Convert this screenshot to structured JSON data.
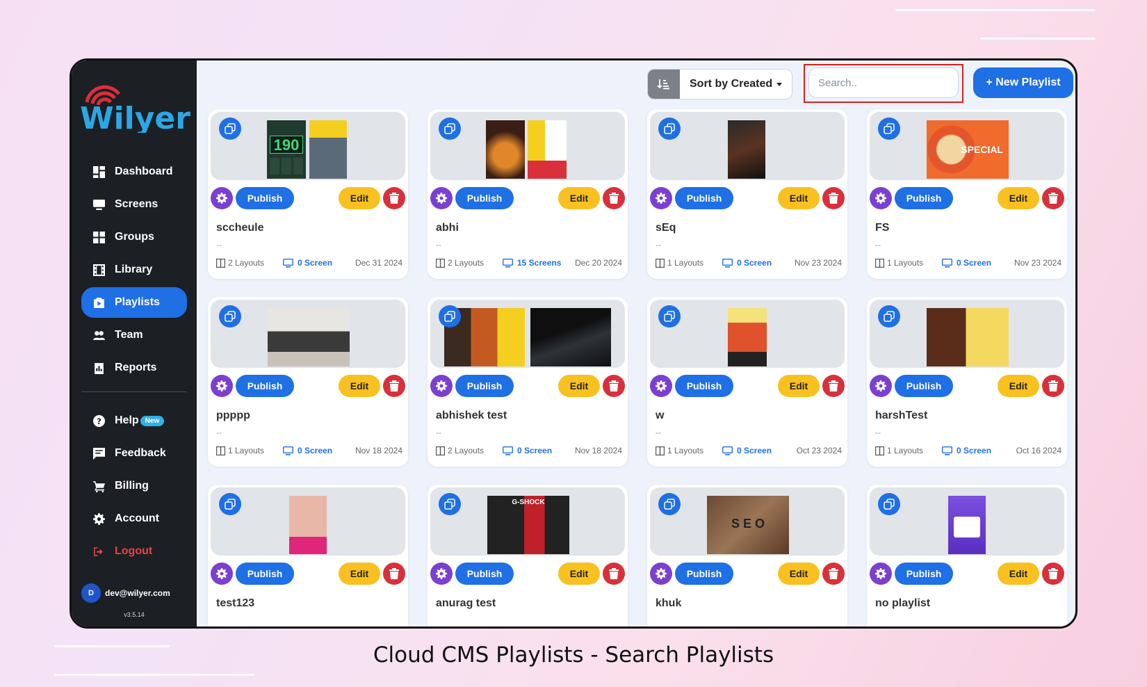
{
  "brand": {
    "logo_text": "Wilyer",
    "accent": "#1f6fe5"
  },
  "sidebar": {
    "items": [
      {
        "label": "Dashboard",
        "icon": "dashboard-icon"
      },
      {
        "label": "Screens",
        "icon": "monitor-icon"
      },
      {
        "label": "Groups",
        "icon": "grid-icon"
      },
      {
        "label": "Library",
        "icon": "film-icon"
      },
      {
        "label": "Playlists",
        "icon": "playlist-icon",
        "active": true
      },
      {
        "label": "Team",
        "icon": "users-icon"
      },
      {
        "label": "Reports",
        "icon": "report-icon"
      }
    ],
    "bottom_items": [
      {
        "label": "Help",
        "badge": "New",
        "icon": "help-icon"
      },
      {
        "label": "Feedback",
        "icon": "feedback-icon"
      },
      {
        "label": "Billing",
        "icon": "cart-icon"
      },
      {
        "label": "Account",
        "icon": "gear-icon"
      },
      {
        "label": "Logout",
        "icon": "logout-icon"
      }
    ],
    "user": {
      "avatar_initial": "D",
      "email": "dev@wilyer.com"
    },
    "version": "v3.5.14"
  },
  "toolbar": {
    "sort_label": "Sort by Created",
    "search_placeholder": "Search..",
    "new_playlist_label": "+ New Playlist"
  },
  "card_labels": {
    "publish": "Publish",
    "edit": "Edit"
  },
  "playlists": [
    {
      "name": "sccheule",
      "desc": "--",
      "layouts": "2 Layouts",
      "screens": "0 Screen",
      "date": "Dec 31 2024"
    },
    {
      "name": "abhi",
      "desc": "--",
      "layouts": "2 Layouts",
      "screens": "15 Screens",
      "date": "Dec 20 2024"
    },
    {
      "name": "sEq",
      "desc": "--",
      "layouts": "1 Layouts",
      "screens": "0 Screen",
      "date": "Nov 23 2024"
    },
    {
      "name": "FS",
      "desc": "--",
      "layouts": "1 Layouts",
      "screens": "0 Screen",
      "date": "Nov 23 2024"
    },
    {
      "name": "ppppp",
      "desc": "--",
      "layouts": "1 Layouts",
      "screens": "0 Screen",
      "date": "Nov 18 2024"
    },
    {
      "name": "abhishek test",
      "desc": "--",
      "layouts": "2 Layouts",
      "screens": "0 Screen",
      "date": "Nov 18 2024"
    },
    {
      "name": "w",
      "desc": "--",
      "layouts": "1 Layouts",
      "screens": "0 Screen",
      "date": "Oct 23 2024"
    },
    {
      "name": "harshTest",
      "desc": "--",
      "layouts": "1 Layouts",
      "screens": "0 Screen",
      "date": "Oct 16 2024"
    },
    {
      "name": "test123",
      "desc": "",
      "layouts": "",
      "screens": "",
      "date": ""
    },
    {
      "name": "anurag test",
      "desc": "",
      "layouts": "",
      "screens": "",
      "date": ""
    },
    {
      "name": "khuk",
      "desc": "",
      "layouts": "",
      "screens": "",
      "date": ""
    },
    {
      "name": "no playlist",
      "desc": "",
      "layouts": "",
      "screens": "",
      "date": ""
    }
  ],
  "thumbnail_text": {
    "counter_value": "190",
    "gshock": "G-SHOCK",
    "seo_letters": "S E O",
    "special": "SPECIAL"
  },
  "caption": "Cloud CMS Playlists - Search Playlists"
}
